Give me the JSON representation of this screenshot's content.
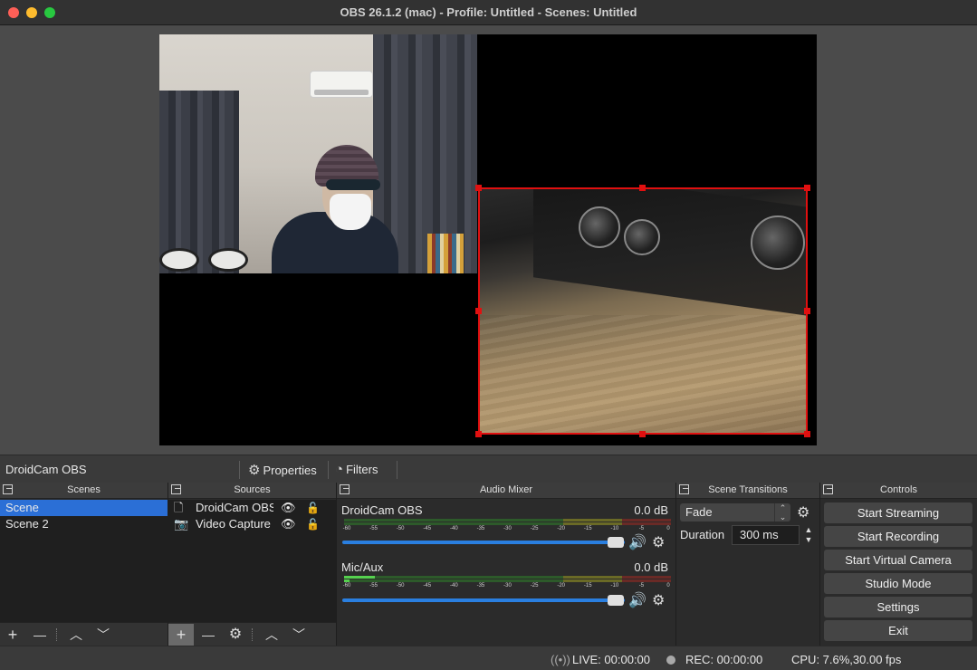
{
  "window": {
    "title": "OBS 26.1.2 (mac) - Profile: Untitled - Scenes: Untitled"
  },
  "context_bar": {
    "source_name": "DroidCam OBS",
    "properties_label": "Properties",
    "filters_label": "Filters"
  },
  "scenes": {
    "title": "Scenes",
    "items": [
      {
        "label": "Scene",
        "selected": true
      },
      {
        "label": "Scene 2",
        "selected": false
      }
    ],
    "toolbar": {
      "add": "+",
      "remove": "—",
      "up": "︿",
      "down": "﹀"
    }
  },
  "sources": {
    "title": "Sources",
    "items": [
      {
        "label": "DroidCam OBS",
        "icon": "file-icon"
      },
      {
        "label": "Video Capture Device",
        "icon": "camera-icon"
      }
    ],
    "toolbar": {
      "add": "+",
      "remove": "—",
      "up": "︿",
      "down": "﹀"
    }
  },
  "audio_mixer": {
    "title": "Audio Mixer",
    "channels": [
      {
        "name": "DroidCam OBS",
        "db": "0.0 dB",
        "level": 0,
        "volume": 1.0
      },
      {
        "name": "Mic/Aux",
        "db": "0.0 dB",
        "level": 0.09,
        "volume": 1.0
      }
    ],
    "ticks": [
      "-60",
      "-55",
      "-50",
      "-45",
      "-40",
      "-35",
      "-30",
      "-25",
      "-20",
      "-15",
      "-10",
      "-5",
      "0"
    ]
  },
  "scene_transitions": {
    "title": "Scene Transitions",
    "transition": "Fade",
    "duration_label": "Duration",
    "duration_value": "300 ms"
  },
  "controls": {
    "title": "Controls",
    "buttons": [
      "Start Streaming",
      "Start Recording",
      "Start Virtual Camera",
      "Studio Mode",
      "Settings",
      "Exit"
    ]
  },
  "status": {
    "live": "LIVE: 00:00:00",
    "rec": "REC: 00:00:00",
    "cpu": "CPU: 7.6%,30.00 fps"
  },
  "colors": {
    "accent": "#2b6fd6",
    "selection": "#e01010"
  }
}
